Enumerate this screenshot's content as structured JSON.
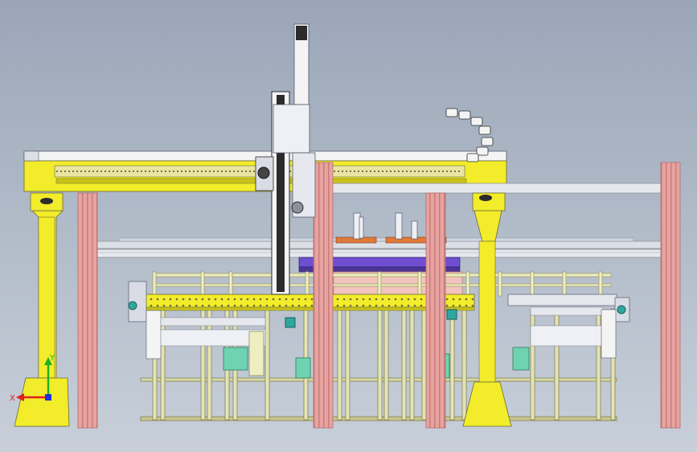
{
  "view": {
    "background_top": "#9aa6b8",
    "background_bottom": "#c8cfd9"
  },
  "colors": {
    "frame_yellow": "#f2ec2a",
    "yellow_shadow": "#c9c21a",
    "pillar_pink": "#e8a3a0",
    "pillar_pink_dark": "#b56d6a",
    "aluminum": "#dcdfe6",
    "aluminum_dark": "#8c919c",
    "guard_cream": "#efeec0",
    "guard_dark": "#9f9d6c",
    "machine_green": "#6fd3b1",
    "tray_orange": "#e07a3a",
    "tray_purple": "#6f4fd0",
    "axis_x": "#e02020",
    "axis_y": "#20b020",
    "axis_z": "#2030e0"
  },
  "triad": {
    "x_label": "X",
    "y_label": "Y"
  },
  "icons": {
    "cable_chain": "cable-chain-icon",
    "servo_motor": "servo-motor-icon",
    "coordinate_triad": "axis-triad-icon"
  }
}
